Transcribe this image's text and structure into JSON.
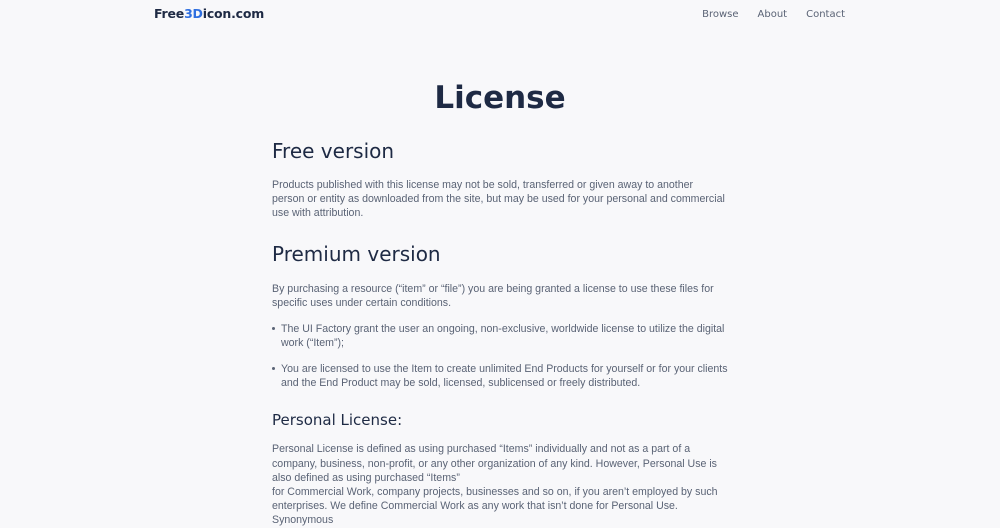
{
  "header": {
    "logo_prefix": "Free",
    "logo_accent": "3D",
    "logo_suffix": "icon.com",
    "nav": [
      "Browse",
      "About",
      "Contact"
    ]
  },
  "page": {
    "title": "License",
    "free": {
      "heading": "Free version",
      "body": "Products published with this license may not be sold, transferred or given away to another person or entity as downloaded from the site, but may be used for your personal and commercial use with attribution."
    },
    "premium": {
      "heading": "Premium version",
      "body": "By purchasing a resource (“item” or “file”) you are being granted a license to use these files for specific uses under certain conditions.",
      "bullets": [
        "The UI Factory grant the user an ongoing, non-exclusive, worldwide license to utilize the digital work (“Item”);",
        "You are licensed to use the Item to create unlimited End Products for yourself or for your clients and the End Product may be sold, licensed, sublicensed or freely distributed."
      ]
    },
    "personal": {
      "heading": "Personal License:",
      "body_1": "Personal License is defined as using purchased “Items” individually and not as a part of a company, business, non-profit, or any other organization of any kind. However, Personal Use is also defined as using purchased “Items”",
      "body_2": "for Commercial Work, company projects, businesses and so on, if you aren’t employed by such enterprises. We define Commercial Work as any work that isn’t done for Personal Use. Synonymous"
    }
  },
  "colors": {
    "accent": "#2f6fe0",
    "heading": "#1e2a44",
    "body_text": "#5a6375",
    "background": "#f8f8fa"
  }
}
